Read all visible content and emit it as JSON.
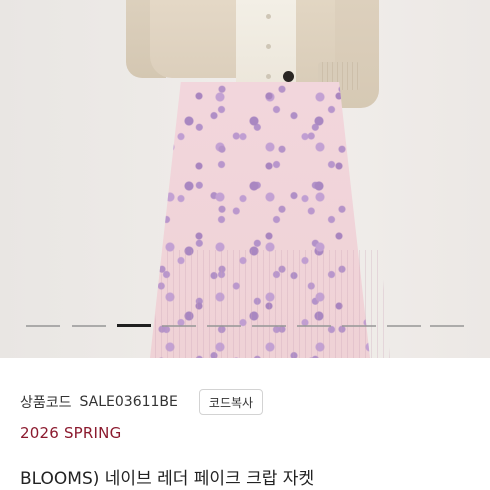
{
  "product": {
    "code_label": "상품코드",
    "code_value": "SALE03611BE",
    "copy_button_label": "코드복사",
    "season": "2026 SPRING",
    "title": "BLOOMS) 네이브 레더 페이크 크랍 자켓"
  },
  "carousel": {
    "total_slides": 10,
    "active_index": 2
  },
  "colors": {
    "season_text": "#8b1a2e",
    "indicator_active": "#1f1f1f",
    "indicator_inactive": "#969696"
  }
}
